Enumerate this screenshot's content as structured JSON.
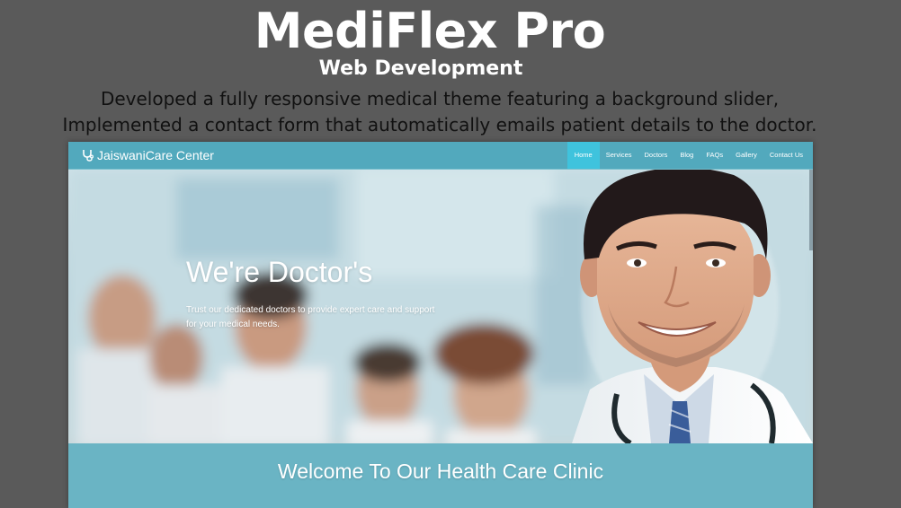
{
  "header": {
    "title": "MediFlex Pro",
    "subtitle": "Web Development",
    "description_lines": [
      "Developed a fully responsive medical theme featuring a background slider,",
      "Implemented a contact form that automatically emails patient details to the doctor."
    ]
  },
  "website": {
    "brand": {
      "name": "JaiswaniCare Center",
      "icon": "stethoscope-icon"
    },
    "nav": [
      {
        "label": "Home",
        "active": true
      },
      {
        "label": "Services",
        "active": false
      },
      {
        "label": "Doctors",
        "active": false
      },
      {
        "label": "Blog",
        "active": false
      },
      {
        "label": "FAQs",
        "active": false
      },
      {
        "label": "Gallery",
        "active": false
      },
      {
        "label": "Contact Us",
        "active": false
      }
    ],
    "hero": {
      "heading": "We're Doctor's",
      "text": "Trust our dedicated doctors to provide expert care and support for your medical needs."
    },
    "welcome": {
      "heading": "Welcome To Our Health Care Clinic"
    },
    "colors": {
      "navbar": "#52a9bd",
      "nav_active": "#3fc3dd",
      "band": "#6ab4c4",
      "page_background": "#5a5a5a"
    }
  }
}
